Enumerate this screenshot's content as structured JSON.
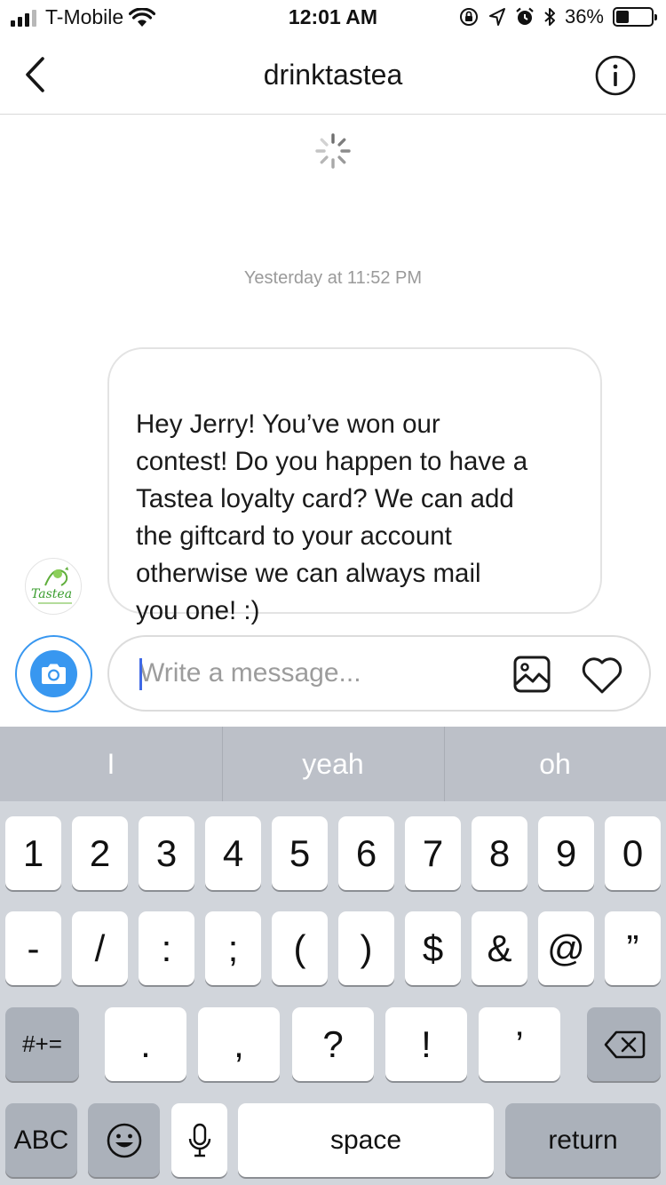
{
  "status_bar": {
    "carrier": "T-Mobile",
    "time": "12:01 AM",
    "battery_percent": "36%",
    "battery_level": 0.36,
    "icons": [
      "signal-icon",
      "wifi-icon",
      "orientation-lock-icon",
      "location-icon",
      "alarm-icon",
      "bluetooth-icon",
      "battery-icon"
    ]
  },
  "header": {
    "title": "drinktastea",
    "back_icon": "chevron-left-icon",
    "info_icon": "info-icon"
  },
  "conversation": {
    "loading_icon": "spinner-icon",
    "timestamp": "Yesterday at 11:52 PM",
    "messages": [
      {
        "sender": "drinktastea",
        "avatar_text": "Tastea",
        "text": "Hey Jerry! You’ve won our\ncontest! Do you happen to have a\nTastea loyalty card? We can add\nthe giftcard to your account\notherwise we can always mail\nyou one! :)"
      }
    ]
  },
  "composer": {
    "placeholder": "Write a message...",
    "value": "",
    "camera_icon": "camera-icon",
    "gallery_icon": "gallery-icon",
    "like_icon": "heart-icon",
    "accent_color": "#3897f0"
  },
  "keyboard": {
    "suggestions": [
      "I",
      "yeah",
      "oh"
    ],
    "row1": [
      "1",
      "2",
      "3",
      "4",
      "5",
      "6",
      "7",
      "8",
      "9",
      "0"
    ],
    "row2": [
      "-",
      "/",
      ":",
      ";",
      "(",
      ")",
      "$",
      "&",
      "@",
      "”"
    ],
    "row3": {
      "mode_key": "#+=",
      "keys": [
        ".",
        ",",
        "?",
        "!",
        "’"
      ],
      "delete_icon": "backspace-icon"
    },
    "row4": {
      "abc": "ABC",
      "emoji_icon": "emoji-icon",
      "mic_icon": "microphone-icon",
      "space": "space",
      "return": "return"
    }
  }
}
